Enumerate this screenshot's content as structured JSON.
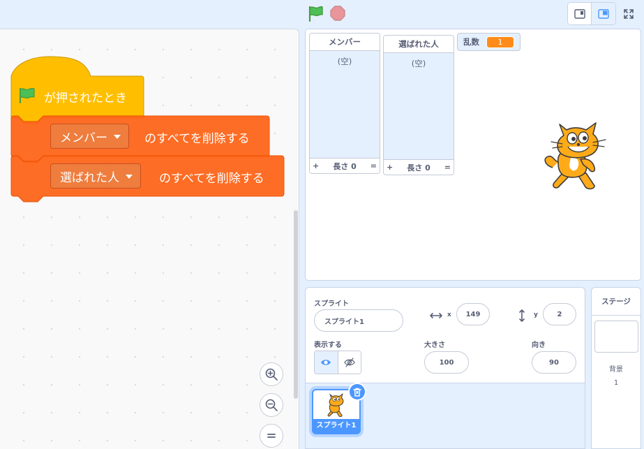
{
  "topbar": {
    "green_flag": "green-flag-icon",
    "stop": "stop-icon",
    "layout_modes": [
      "small-stage-mode-icon",
      "normal-stage-mode-icon"
    ],
    "fullscreen": "fullscreen-icon"
  },
  "code": {
    "hat_block_label": "が押されたとき",
    "block1_dropdown": "メンバー",
    "block1_text": "のすべてを削除する",
    "block2_dropdown": "選ばれた人",
    "block2_text": "のすべてを削除する",
    "colors": {
      "events": "#ffbf00",
      "lists": "#ff661a"
    }
  },
  "stage": {
    "lists": [
      {
        "title": "メンバー",
        "empty_text": "(空)",
        "length_label": "長さ 0",
        "add": "+",
        "resize": "="
      },
      {
        "title": "選ばれた人",
        "empty_text": "(空)",
        "length_label": "長さ 0",
        "add": "+",
        "resize": "="
      }
    ],
    "variable": {
      "name": "乱数",
      "value": "1"
    }
  },
  "sprite_info": {
    "sprite_label": "スプライト",
    "sprite_name": "スプライト1",
    "x_label": "x",
    "x_value": "149",
    "y_label": "y",
    "y_value": "2",
    "show_label": "表示する",
    "size_label": "大きさ",
    "size_value": "100",
    "direction_label": "向き",
    "direction_value": "90"
  },
  "sprite_list": {
    "tiles": [
      {
        "name": "スプライト1"
      }
    ]
  },
  "stage_selector": {
    "title": "ステージ",
    "backdrop_label": "背景",
    "backdrop_count": "1"
  }
}
